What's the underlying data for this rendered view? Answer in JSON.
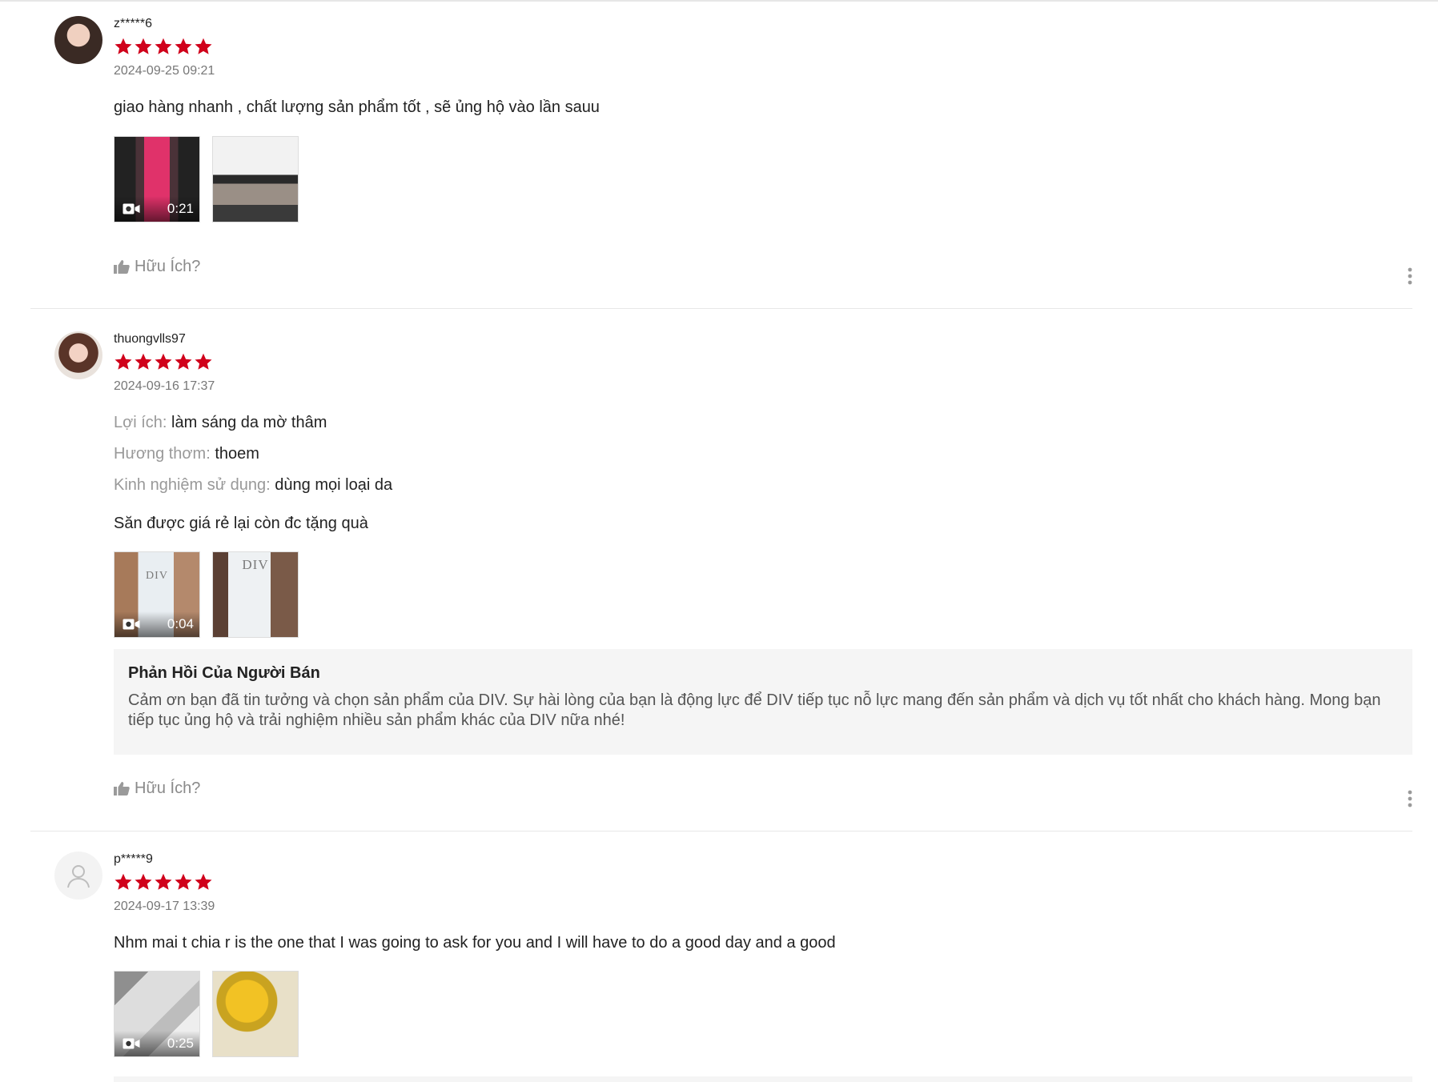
{
  "reviews": [
    {
      "username": "z*****6",
      "rating": 5,
      "datetime": "2024-09-25 09:21",
      "comment": "giao hàng nhanh , chất lượng sản phẩm tốt , sẽ ủng hộ vào lần sauu",
      "media": [
        {
          "type": "video",
          "duration": "0:21"
        },
        {
          "type": "image"
        }
      ],
      "helpful_label": "Hữu Ích?"
    },
    {
      "username": "thuongvlls97",
      "rating": 5,
      "datetime": "2024-09-16 17:37",
      "attributes": [
        {
          "label": "Lợi ích:",
          "value": "làm sáng da mờ thâm"
        },
        {
          "label": "Hương thơm:",
          "value": "thoem"
        },
        {
          "label": "Kinh nghiệm sử dụng:",
          "value": "dùng mọi loại da"
        }
      ],
      "comment": "Săn được giá rẻ lại còn đc tặng quà",
      "media": [
        {
          "type": "video",
          "duration": "0:04",
          "brand_text": "DIV"
        },
        {
          "type": "image",
          "brand_text": "DIV"
        }
      ],
      "seller_reply": {
        "title": "Phản Hồi Của Người Bán",
        "text": "Cảm ơn bạn đã tin tưởng và chọn sản phẩm của DIV. Sự hài lòng của bạn là động lực để DIV tiếp tục nỗ lực mang đến sản phẩm và dịch vụ tốt nhất cho khách hàng. Mong bạn tiếp tục ủng hộ và trải nghiệm nhiều sản phẩm khác của DIV nữa nhé!"
      },
      "helpful_label": "Hữu Ích?"
    },
    {
      "username": "p*****9",
      "rating": 5,
      "datetime": "2024-09-17 13:39",
      "comment": "Nhm mai t chia r is the one that I was going to ask for you and I will have to do a good day and a good",
      "media": [
        {
          "type": "video",
          "duration": "0:25"
        },
        {
          "type": "image"
        }
      ]
    }
  ],
  "colors": {
    "star": "#d0011b",
    "muted_text": "#999999",
    "divider": "#e8e8e8",
    "reply_background": "#f5f5f5"
  },
  "icons": [
    "star-icon",
    "video-camera-icon",
    "thumbs-up-icon",
    "more-vertical-icon",
    "user-placeholder-icon"
  ]
}
